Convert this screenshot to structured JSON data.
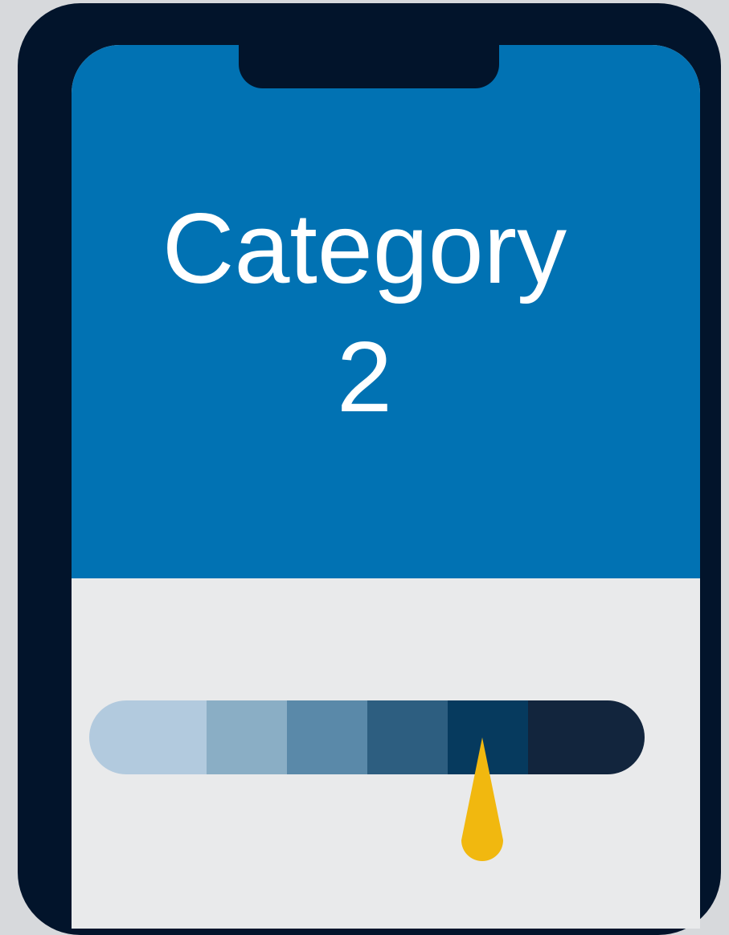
{
  "title": {
    "line1": "Category",
    "line2": "2"
  },
  "colors": {
    "background": "#d7d9dc",
    "phone_frame": "#02142b",
    "screen_top": "#0172b3",
    "screen_bottom": "#e9eaeb",
    "pointer": "#f1b80f"
  },
  "scale": {
    "segments": [
      {
        "color": "#b2cade"
      },
      {
        "color": "#8aaec5"
      },
      {
        "color": "#5a89a9"
      },
      {
        "color": "#2d5e80"
      },
      {
        "color": "#063a5e"
      },
      {
        "color": "#12253d"
      }
    ],
    "selected_segment": 5
  }
}
